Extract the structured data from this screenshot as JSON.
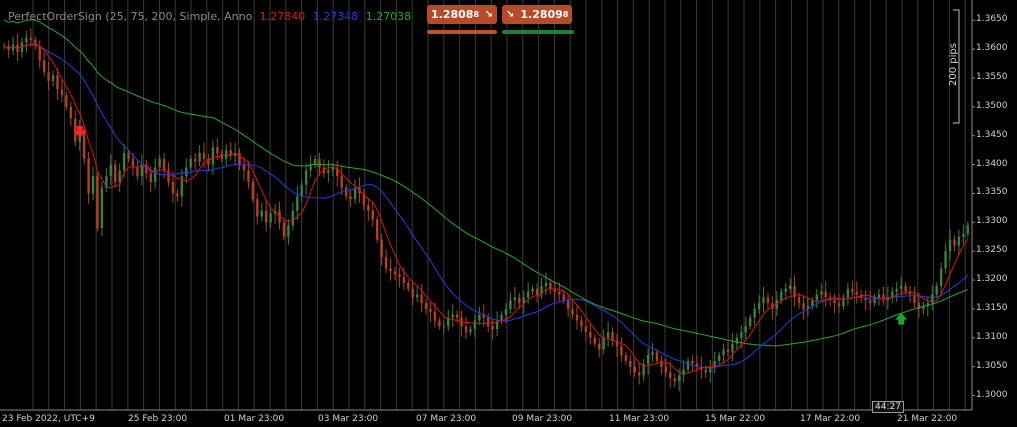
{
  "indicator": {
    "name": "PerfectOrderSign (25, 75, 200, Simple, Anno",
    "ma_fast": "1.27840",
    "ma_mid": "1.27348",
    "ma_slow": "1.27038"
  },
  "trade": {
    "sell_price": "1.2808",
    "sell_super": "8",
    "buy_price": "1.2809",
    "buy_super": "8"
  },
  "colors": {
    "background": "#000000",
    "ma_fast": "#e01010",
    "ma_mid": "#1f3fe0",
    "ma_slow": "#28a828",
    "candle_up": "#3f7f3f",
    "candle_down": "#b0421f",
    "sell_button": "#b84a2a",
    "buy_button": "#b84a2a",
    "sell_volume": "#c0502a",
    "buy_volume": "#1e7e3a"
  },
  "price_axis": {
    "labels": [
      "1.3650",
      "1.3600",
      "1.3550",
      "1.3500",
      "1.3450",
      "1.3400",
      "1.3350",
      "1.3300",
      "1.3250",
      "1.3200",
      "1.3150",
      "1.3100",
      "1.3050",
      "1.3000"
    ],
    "pips_label": "200 pips"
  },
  "time_axis": {
    "labels": [
      "23 Feb 2022, UTC+9",
      "25 Feb 23:00",
      "01 Mar 23:00",
      "03 Mar 23:00",
      "07 Mar 23:00",
      "09 Mar 23:00",
      "11 Mar 23:00",
      "15 Mar 22:00",
      "17 Mar 22:00",
      "21 Mar 22:00"
    ],
    "countdown": "44:27"
  },
  "chart_data": {
    "type": "candlestick",
    "ylim": [
      1.2975,
      1.3685
    ],
    "signals": [
      {
        "type": "sell",
        "index": 17,
        "price": 1.3455
      },
      {
        "type": "buy",
        "index": 202,
        "price": 1.3135
      }
    ],
    "close": [
      1.3605,
      1.3598,
      1.3608,
      1.3595,
      1.3612,
      1.362,
      1.3616,
      1.3605,
      1.358,
      1.356,
      1.3545,
      1.3555,
      1.353,
      1.352,
      1.35,
      1.348,
      1.344,
      1.346,
      1.341,
      1.335,
      1.338,
      1.329,
      1.336,
      1.338,
      1.34,
      1.337,
      1.339,
      1.342,
      1.341,
      1.3395,
      1.338,
      1.34,
      1.3385,
      1.337,
      1.3395,
      1.341,
      1.339,
      1.337,
      1.335,
      1.3345,
      1.338,
      1.3395,
      1.341,
      1.3405,
      1.342,
      1.341,
      1.34,
      1.343,
      1.342,
      1.341,
      1.3425,
      1.3415,
      1.342,
      1.34,
      1.339,
      1.337,
      1.334,
      1.331,
      1.332,
      1.33,
      1.3315,
      1.332,
      1.33,
      1.3275,
      1.3295,
      1.332,
      1.3345,
      1.3365,
      1.339,
      1.34,
      1.341,
      1.3395,
      1.3385,
      1.339,
      1.3395,
      1.338,
      1.336,
      1.3345,
      1.334,
      1.336,
      1.335,
      1.333,
      1.332,
      1.3305,
      1.327,
      1.324,
      1.322,
      1.3215,
      1.321,
      1.3205,
      1.3195,
      1.3185,
      1.317,
      1.3175,
      1.316,
      1.315,
      1.3145,
      1.313,
      1.312,
      1.312,
      1.3135,
      1.314,
      1.3135,
      1.312,
      1.311,
      1.3115,
      1.313,
      1.314,
      1.3135,
      1.312,
      1.3115,
      1.313,
      1.314,
      1.315,
      1.3165,
      1.317,
      1.316,
      1.317,
      1.318,
      1.3185,
      1.3175,
      1.319,
      1.3195,
      1.3185,
      1.318,
      1.3175,
      1.3165,
      1.315,
      1.314,
      1.313,
      1.312,
      1.311,
      1.31,
      1.309,
      1.308,
      1.31,
      1.311,
      1.3095,
      1.3085,
      1.307,
      1.306,
      1.305,
      1.304,
      1.3035,
      1.3055,
      1.307,
      1.3075,
      1.306,
      1.305,
      1.304,
      1.303,
      1.3025,
      1.3035,
      1.3045,
      1.306,
      1.3055,
      1.305,
      1.3045,
      1.304,
      1.305,
      1.306,
      1.307,
      1.308,
      1.3075,
      1.309,
      1.31,
      1.311,
      1.312,
      1.3135,
      1.315,
      1.316,
      1.317,
      1.316,
      1.315,
      1.3165,
      1.318,
      1.3185,
      1.319,
      1.317,
      1.316,
      1.315,
      1.3155,
      1.3165,
      1.3175,
      1.318,
      1.317,
      1.3165,
      1.316,
      1.3155,
      1.317,
      1.3185,
      1.318,
      1.3175,
      1.317,
      1.3165,
      1.316,
      1.317,
      1.3175,
      1.3165,
      1.317,
      1.318,
      1.3185,
      1.319,
      1.318,
      1.3175,
      1.316,
      1.315,
      1.3155,
      1.316,
      1.3175,
      1.319,
      1.322,
      1.325,
      1.327,
      1.326,
      1.3275,
      1.328,
      1.3295
    ]
  }
}
